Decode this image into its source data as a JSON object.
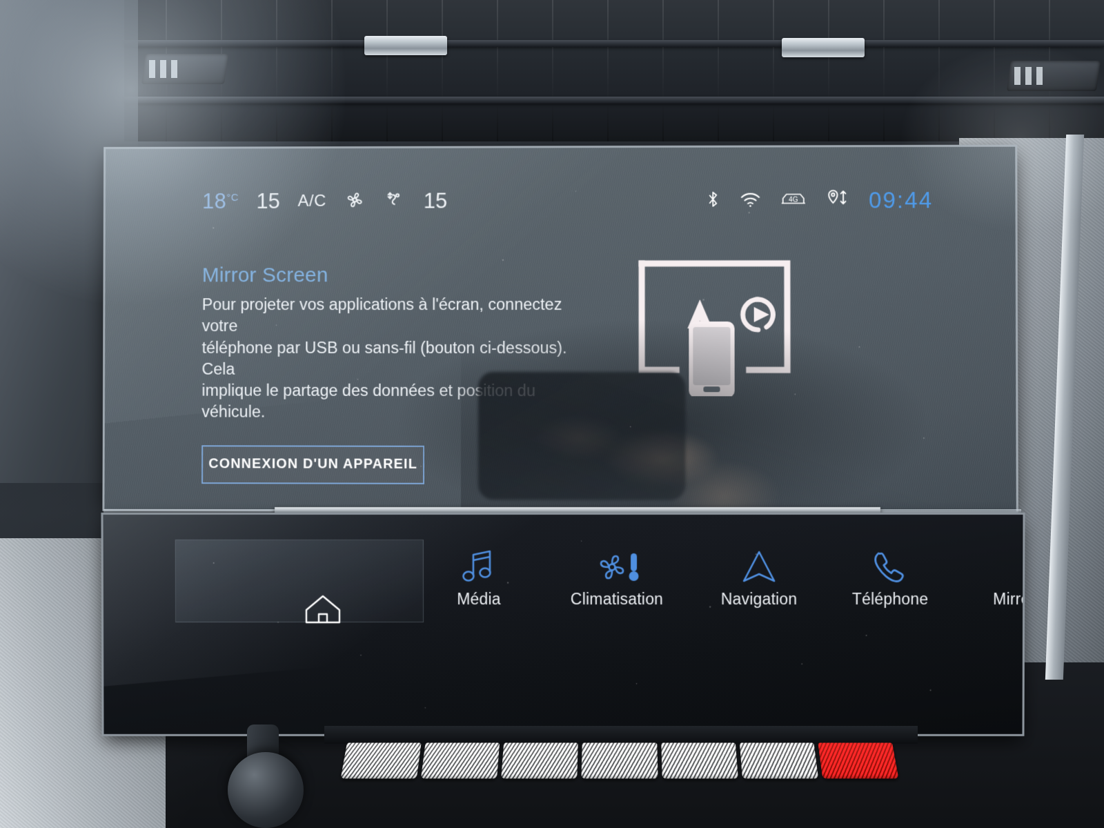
{
  "status_bar": {
    "temperature": "18",
    "temperature_unit": "°C",
    "left_fan_level": "15",
    "ac_label": "A/C",
    "fan_icon": "fan-icon",
    "airflow_icon": "airflow-direction-icon",
    "right_fan_level": "15",
    "bluetooth_icon": "bluetooth-icon",
    "wifi_icon": "wifi-icon",
    "network_icon": "4g-connected-car-icon",
    "network_label": "4G",
    "location_icon": "location-sharing-icon",
    "clock": "09:44",
    "clock_color": "#4f9bea",
    "temp_color": "#8fb7e6"
  },
  "main": {
    "title": "Mirror Screen",
    "title_color": "#7fb0e0",
    "body_lines": [
      "Pour projeter vos applications à l'écran, connectez votre",
      "téléphone par USB ou sans-fil (bouton ci-dessous). Cela",
      "implique le partage des données et position du",
      "véhicule."
    ],
    "button_label": "CONNEXION D'UN APPAREIL",
    "button_border_color": "#7ea6d6",
    "illustration": {
      "name": "mirror-screen-illustration",
      "parts": [
        "display-frame",
        "android-auto-icon",
        "carplay-play-icon",
        "smartphone-icon"
      ]
    }
  },
  "nav_bar": {
    "items": [
      {
        "label": "",
        "icon": "home-icon",
        "icon_color": "#ffffff",
        "name": "nav-home"
      },
      {
        "label": "Média",
        "icon": "music-note-icon",
        "icon_color": "#4f8fe0",
        "name": "nav-media"
      },
      {
        "label": "Climatisation",
        "icon": "fan-thermometer-icon",
        "icon_color": "#4f8fe0",
        "name": "nav-climate"
      },
      {
        "label": "Navigation",
        "icon": "navigation-arrow-icon",
        "icon_color": "#4f8fe0",
        "name": "nav-navigation"
      },
      {
        "label": "Téléphone",
        "icon": "phone-handset-icon",
        "icon_color": "#4f8fe0",
        "name": "nav-phone"
      },
      {
        "label": "Mirror Screen",
        "icon": "mirror-screen-icon",
        "icon_color": "#4f8fe0",
        "name": "nav-mirror-screen"
      }
    ]
  },
  "physical_controls": {
    "toggle_keys": [
      {
        "name": "key-demist-rear",
        "color": "#e8ebee"
      },
      {
        "name": "key-demist-front",
        "color": "#e8ebee"
      },
      {
        "name": "key-air-recirculation",
        "color": "#e8ebee"
      },
      {
        "name": "key-auto-climate",
        "color": "#e8ebee"
      },
      {
        "name": "key-airflow",
        "color": "#e8ebee"
      },
      {
        "name": "key-climate-off",
        "color": "#e8ebee"
      },
      {
        "name": "key-hazard-lights",
        "color": "#e03127"
      }
    ]
  }
}
